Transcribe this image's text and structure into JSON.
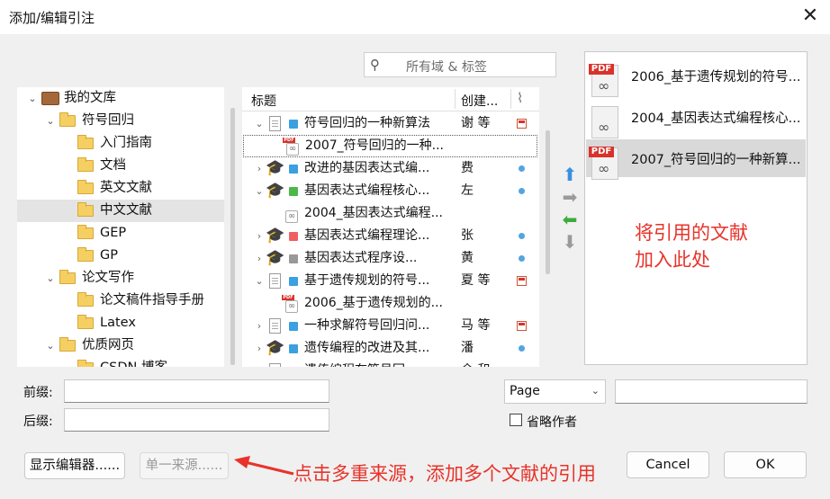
{
  "window": {
    "title": "添加/编辑引注",
    "close_glyph": "✕"
  },
  "search": {
    "placeholder": "所有域 & 标签",
    "icon": "search-icon"
  },
  "library_tree": {
    "items": [
      {
        "label": "我的文库",
        "type": "library",
        "expanded": true
      },
      {
        "label": "符号回归",
        "type": "folder",
        "expanded": true
      },
      {
        "label": "入门指南",
        "type": "folder"
      },
      {
        "label": "文档",
        "type": "folder"
      },
      {
        "label": "英文文献",
        "type": "folder"
      },
      {
        "label": "中文文献",
        "type": "folder",
        "selected": true
      },
      {
        "label": "GEP",
        "type": "folder"
      },
      {
        "label": "GP",
        "type": "folder"
      },
      {
        "label": "论文写作",
        "type": "folder",
        "expanded": true
      },
      {
        "label": "论文稿件指导手册",
        "type": "folder"
      },
      {
        "label": "Latex",
        "type": "folder"
      },
      {
        "label": "优质网页",
        "type": "folder",
        "expanded": true
      },
      {
        "label": "CSDN 博客",
        "type": "folder"
      }
    ]
  },
  "item_list": {
    "columns": {
      "title": "标题",
      "creator": "创建...",
      "attachment_icon": "paperclip-icon"
    },
    "rows": [
      {
        "title": "符号回归的一种新算法",
        "creator": "谢 等",
        "icon": "document",
        "tag_color": "#3aa0e0",
        "twisty": "open",
        "attachment": "pdf"
      },
      {
        "title": "2007_符号回归的一种...",
        "creator": "",
        "icon": "pdf",
        "child": true,
        "selected": true
      },
      {
        "title": "改进的基因表达式编...",
        "creator": "费",
        "icon": "thesis",
        "tag_color": "#3aa0e0",
        "twisty": "closed",
        "attachment": "dot"
      },
      {
        "title": "基因表达式编程核心...",
        "creator": "左",
        "icon": "thesis",
        "tag_color": "#4cb848",
        "twisty": "open",
        "attachment": "dot"
      },
      {
        "title": "2004_基因表达式编程...",
        "creator": "",
        "icon": "link",
        "child": true
      },
      {
        "title": "基因表达式编程理论...",
        "creator": "张",
        "icon": "thesis",
        "tag_color": "#f06060",
        "twisty": "closed",
        "attachment": "dot"
      },
      {
        "title": "基因表达式程序设...",
        "creator": "黄",
        "icon": "thesis",
        "tag_color": "#999999",
        "twisty": "closed",
        "attachment": "dot"
      },
      {
        "title": "基于遗传规划的符号...",
        "creator": "夏 等",
        "icon": "document",
        "tag_color": "#3aa0e0",
        "twisty": "open",
        "attachment": "pdf"
      },
      {
        "title": "2006_基于遗传规划的...",
        "creator": "",
        "icon": "pdf",
        "child": true
      },
      {
        "title": "一种求解符号回归问...",
        "creator": "马 等",
        "icon": "document",
        "tag_color": "#3aa0e0",
        "twisty": "closed",
        "attachment": "pdf"
      },
      {
        "title": "遗传编程的改进及其...",
        "creator": "潘",
        "icon": "thesis",
        "tag_color": "#3aa0e0",
        "twisty": "closed",
        "attachment": "dot"
      },
      {
        "title": "遗传编程在符号回...",
        "creator": "余 和",
        "icon": "document",
        "tag_color": "#3aa0e0",
        "twisty": "closed",
        "attachment": "dot"
      }
    ]
  },
  "move_buttons": {
    "up": "⬆",
    "right": "➡",
    "left": "⬅",
    "down": "⬇",
    "up_color": "#3b8fe0",
    "left_color": "#3dab3d"
  },
  "citations": {
    "items": [
      {
        "label": "2006_基于遗传规划的符号..."
      },
      {
        "label": "2004_基因表达式编程核心..."
      },
      {
        "label": "2007_符号回归的一种新算..."
      }
    ],
    "annotation": "将引用的文献\n加入此处"
  },
  "form": {
    "prefix_label": "前缀:",
    "suffix_label": "后缀:",
    "locator_value": "Page",
    "omit_author_label": "省略作者"
  },
  "buttons": {
    "show_editor": "显示编辑器......",
    "multiple_sources": "单一来源......",
    "cancel": "Cancel",
    "ok": "OK"
  },
  "bottom_annotation": "点击多重来源，添加多个文献的引用",
  "colors": {
    "annotation_red": "#e8332a",
    "pdf_red": "#d9322b"
  }
}
